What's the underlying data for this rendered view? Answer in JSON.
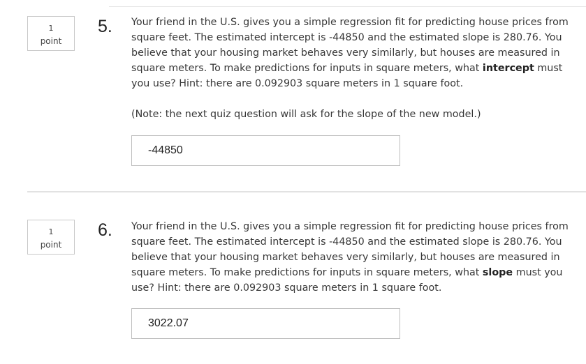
{
  "questions": [
    {
      "points_value": "1",
      "points_label": "point",
      "number": "5.",
      "text_before_bold": "Your friend in the U.S. gives you a simple regression fit for predicting house prices from square feet. The estimated intercept is -44850 and the estimated slope is 280.76. You believe that your housing market behaves very similarly, but houses are measured in square meters. To make predictions for inputs in square meters, what ",
      "bold_word": "intercept",
      "text_after_bold": " must you use? Hint: there are 0.092903 square meters in 1 square foot.",
      "note": "(Note: the next quiz question will ask for the slope of the new model.)",
      "answer_value": "-44850"
    },
    {
      "points_value": "1",
      "points_label": "point",
      "number": "6.",
      "text_before_bold": "Your friend in the U.S. gives you a simple regression fit for predicting house prices from square feet. The estimated intercept is -44850 and the estimated slope is 280.76. You believe that your housing market behaves very similarly, but houses are measured in square meters. To make predictions for inputs in square meters, what ",
      "bold_word": "slope",
      "text_after_bold": " must you use? Hint: there are 0.092903 square meters in 1 square foot.",
      "answer_value": "3022.07"
    }
  ]
}
